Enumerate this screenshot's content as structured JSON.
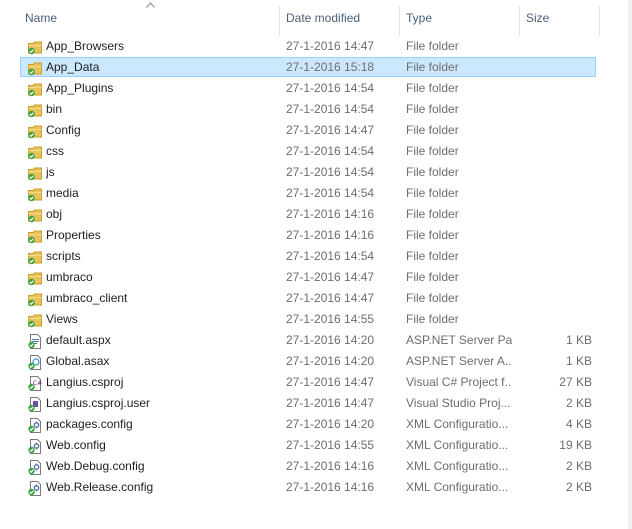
{
  "columns": {
    "name": "Name",
    "date": "Date modified",
    "type": "Type",
    "size": "Size"
  },
  "sort": {
    "column": "name",
    "direction": "ascending"
  },
  "colors": {
    "selection_bg": "#cce8ff",
    "selection_border": "#99d1ff",
    "header_text": "#4c607a",
    "folder": "#e8c25a",
    "sync_check": "#39a33e"
  },
  "files": [
    {
      "name": "App_Browsers",
      "date": "27-1-2016 14:47",
      "type": "File folder",
      "size": "",
      "icon": "folder-icon"
    },
    {
      "name": "App_Data",
      "date": "27-1-2016 15:18",
      "type": "File folder",
      "size": "",
      "icon": "folder-icon",
      "selected": true
    },
    {
      "name": "App_Plugins",
      "date": "27-1-2016 14:54",
      "type": "File folder",
      "size": "",
      "icon": "folder-icon"
    },
    {
      "name": "bin",
      "date": "27-1-2016 14:54",
      "type": "File folder",
      "size": "",
      "icon": "folder-icon"
    },
    {
      "name": "Config",
      "date": "27-1-2016 14:47",
      "type": "File folder",
      "size": "",
      "icon": "folder-icon"
    },
    {
      "name": "css",
      "date": "27-1-2016 14:54",
      "type": "File folder",
      "size": "",
      "icon": "folder-icon"
    },
    {
      "name": "js",
      "date": "27-1-2016 14:54",
      "type": "File folder",
      "size": "",
      "icon": "folder-icon"
    },
    {
      "name": "media",
      "date": "27-1-2016 14:54",
      "type": "File folder",
      "size": "",
      "icon": "folder-icon"
    },
    {
      "name": "obj",
      "date": "27-1-2016 14:16",
      "type": "File folder",
      "size": "",
      "icon": "folder-icon"
    },
    {
      "name": "Properties",
      "date": "27-1-2016 14:16",
      "type": "File folder",
      "size": "",
      "icon": "folder-icon"
    },
    {
      "name": "scripts",
      "date": "27-1-2016 14:54",
      "type": "File folder",
      "size": "",
      "icon": "folder-icon"
    },
    {
      "name": "umbraco",
      "date": "27-1-2016 14:47",
      "type": "File folder",
      "size": "",
      "icon": "folder-icon"
    },
    {
      "name": "umbraco_client",
      "date": "27-1-2016 14:47",
      "type": "File folder",
      "size": "",
      "icon": "folder-icon"
    },
    {
      "name": "Views",
      "date": "27-1-2016 14:55",
      "type": "File folder",
      "size": "",
      "icon": "folder-icon"
    },
    {
      "name": "default.aspx",
      "date": "27-1-2016 14:20",
      "type": "ASP.NET Server Pa...",
      "size": "1 KB",
      "icon": "aspx-file-icon"
    },
    {
      "name": "Global.asax",
      "date": "27-1-2016 14:20",
      "type": "ASP.NET Server A...",
      "size": "1 KB",
      "icon": "asax-file-icon"
    },
    {
      "name": "Langius.csproj",
      "date": "27-1-2016 14:47",
      "type": "Visual C# Project f...",
      "size": "27 KB",
      "icon": "csproj-file-icon"
    },
    {
      "name": "Langius.csproj.user",
      "date": "27-1-2016 14:47",
      "type": "Visual Studio Proj...",
      "size": "2 KB",
      "icon": "user-file-icon"
    },
    {
      "name": "packages.config",
      "date": "27-1-2016 14:20",
      "type": "XML Configuratio...",
      "size": "4 KB",
      "icon": "config-file-icon"
    },
    {
      "name": "Web.config",
      "date": "27-1-2016 14:55",
      "type": "XML Configuratio...",
      "size": "19 KB",
      "icon": "config-file-icon"
    },
    {
      "name": "Web.Debug.config",
      "date": "27-1-2016 14:16",
      "type": "XML Configuratio...",
      "size": "2 KB",
      "icon": "config-file-icon"
    },
    {
      "name": "Web.Release.config",
      "date": "27-1-2016 14:16",
      "type": "XML Configuratio...",
      "size": "2 KB",
      "icon": "config-file-icon"
    }
  ]
}
